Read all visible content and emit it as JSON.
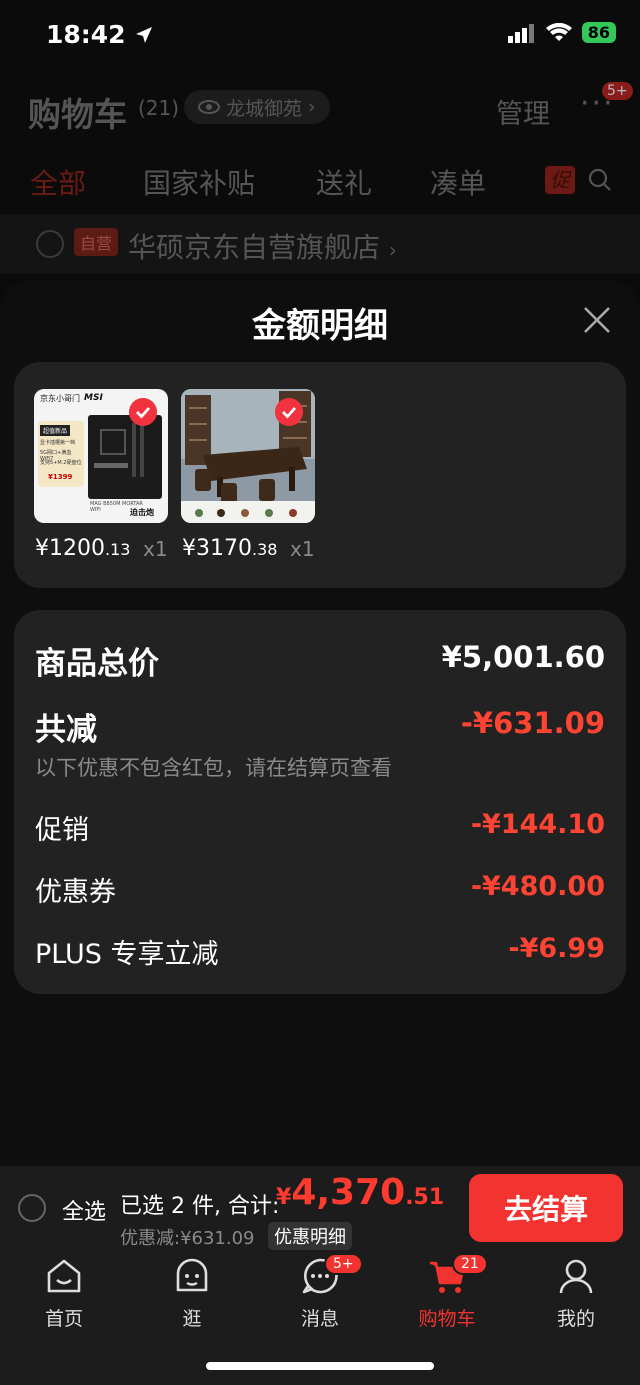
{
  "status": {
    "time": "18:42",
    "battery": "86"
  },
  "header": {
    "title": "购物车",
    "count": "(21)",
    "location": "龙城御苑",
    "manage": "管理",
    "more_badge": "5+"
  },
  "tabs": [
    {
      "label": "全部",
      "active": true
    },
    {
      "label": "国家补贴"
    },
    {
      "label": "送礼"
    },
    {
      "label": "凑单"
    }
  ],
  "promo_tag": "促",
  "store": {
    "tag": "自营",
    "name": "华硕京东自营旗舰店"
  },
  "sheet": {
    "title": "金额明细",
    "items": [
      {
        "price_int": "¥1200",
        "price_dec": ".13",
        "qty": "x1",
        "thumb": "motherboard",
        "checked": true
      },
      {
        "price_int": "¥3170",
        "price_dec": ".38",
        "qty": "x1",
        "thumb": "tea-table",
        "checked": true
      }
    ],
    "total_label": "商品总价",
    "total_value": "¥5,001.60",
    "reduce_label": "共减",
    "reduce_value": "-¥631.09",
    "reduce_note": "以下优惠不包含红包，请在结算页查看",
    "rows": [
      {
        "label": "促销",
        "value": "-¥144.10"
      },
      {
        "label": "优惠券",
        "value": "-¥480.00"
      },
      {
        "label": "PLUS 专享立减",
        "value": "-¥6.99"
      }
    ]
  },
  "thumb1": {
    "brand_left": "京东小哥门",
    "brand_right": "MSI",
    "badge": "超值新品",
    "line1": "显卡插槽第一档",
    "line2": "5G网口+满血WiFi7",
    "line3": "支持5+M.2硬盘位",
    "price": "¥1399",
    "model": "MAG B850M MORTAR WIFI",
    "name": "迫击炮"
  },
  "bottom": {
    "select_all": "全选",
    "selected": "已选 2 件, 合计:",
    "currency": "¥",
    "total_int": "4,370",
    "total_dec": ".51",
    "discount": "优惠减:¥631.09",
    "detail": "优惠明细",
    "checkout": "去结算"
  },
  "nav": [
    {
      "label": "首页",
      "icon": "home-icon"
    },
    {
      "label": "逛",
      "icon": "browse-icon"
    },
    {
      "label": "消息",
      "icon": "message-icon",
      "badge": "5+"
    },
    {
      "label": "购物车",
      "icon": "cart-icon",
      "badge": "21",
      "active": true
    },
    {
      "label": "我的",
      "icon": "profile-icon"
    }
  ],
  "colors": {
    "accent": "#f2332f",
    "discount": "#ff4433",
    "card": "#222222",
    "background": "#0b0b0b"
  }
}
